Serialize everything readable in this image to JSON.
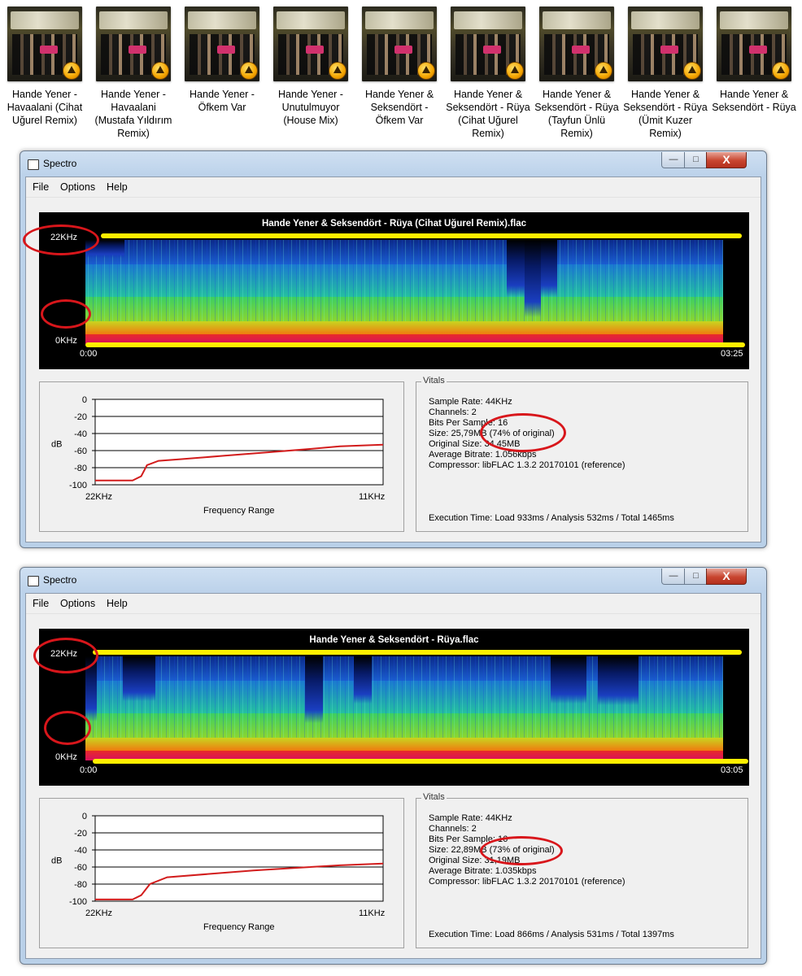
{
  "files": [
    {
      "name": "Hande Yener - Havaalani (Cihat Uğurel Remix)"
    },
    {
      "name": "Hande Yener - Havaalani (Mustafa Yıldırım Remix)"
    },
    {
      "name": "Hande Yener - Öfkem Var"
    },
    {
      "name": "Hande Yener - Unutulmuyor (House Mix)"
    },
    {
      "name": "Hande Yener & Seksendört - Öfkem Var"
    },
    {
      "name": "Hande Yener & Seksendört - Rüya (Cihat Uğurel Remix)"
    },
    {
      "name": "Hande Yener & Seksendört - Rüya (Tayfun Ünlü Remix)"
    },
    {
      "name": "Hande Yener & Seksendört - Rüya (Ümit Kuzer Remix)"
    },
    {
      "name": "Hande Yener & Seksendört - Rüya"
    }
  ],
  "windows": [
    {
      "title": "Spectro",
      "controls": {
        "minimize": "—",
        "maximize": "□",
        "close": "X"
      },
      "menu": [
        "File",
        "Options",
        "Help"
      ],
      "spectrogram": {
        "title": "Hande Yener & Seksendört - Rüya (Cihat Uğurel Remix).flac",
        "y_top": "22KHz",
        "y_bottom": "0KHz",
        "x_start": "0:00",
        "x_end": "03:25"
      },
      "graph": {
        "yticks": [
          "0",
          "-20",
          "-40",
          "-60",
          "-80",
          "-100"
        ],
        "ylabel": "dB",
        "x_left": "22KHz",
        "x_right": "11KHz",
        "xlabel": "Frequency Range",
        "chart_data": {
          "type": "line",
          "ylim": [
            -100,
            0
          ],
          "points": [
            [
              0,
              -95
            ],
            [
              0.13,
              -95
            ],
            [
              0.16,
              -90
            ],
            [
              0.18,
              -77
            ],
            [
              0.22,
              -72
            ],
            [
              0.3,
              -70
            ],
            [
              0.45,
              -66
            ],
            [
              0.6,
              -62
            ],
            [
              0.75,
              -58
            ],
            [
              0.85,
              -55
            ],
            [
              1,
              -53
            ]
          ]
        }
      },
      "vitals": {
        "legend": "Vitals",
        "sample_rate": "Sample Rate: 44KHz",
        "channels": "Channels: 2",
        "bits": "Bits Per Sample: 16",
        "size": "Size: 25,79MB (74% of original)",
        "original": "Original Size: 34,45MB",
        "bitrate": "Average Bitrate: 1.056kbps",
        "compressor": "Compressor: libFLAC 1.3.2 20170101 (reference)",
        "execution": "Execution Time: Load 933ms / Analysis 532ms / Total 1465ms"
      }
    },
    {
      "title": "Spectro",
      "controls": {
        "minimize": "—",
        "maximize": "□",
        "close": "X"
      },
      "menu": [
        "File",
        "Options",
        "Help"
      ],
      "spectrogram": {
        "title": "Hande Yener & Seksendört - Rüya.flac",
        "y_top": "22KHz",
        "y_bottom": "0KHz",
        "x_start": "0:00",
        "x_end": "03:05"
      },
      "graph": {
        "yticks": [
          "0",
          "-20",
          "-40",
          "-60",
          "-80",
          "-100"
        ],
        "ylabel": "dB",
        "x_left": "22KHz",
        "x_right": "11KHz",
        "xlabel": "Frequency Range",
        "chart_data": {
          "type": "line",
          "ylim": [
            -100,
            0
          ],
          "points": [
            [
              0,
              -98
            ],
            [
              0.13,
              -98
            ],
            [
              0.16,
              -93
            ],
            [
              0.19,
              -80
            ],
            [
              0.25,
              -72
            ],
            [
              0.4,
              -68
            ],
            [
              0.55,
              -64
            ],
            [
              0.7,
              -61
            ],
            [
              0.85,
              -58
            ],
            [
              1,
              -56
            ]
          ]
        }
      },
      "vitals": {
        "legend": "Vitals",
        "sample_rate": "Sample Rate: 44KHz",
        "channels": "Channels: 2",
        "bits": "Bits Per Sample: 16",
        "size": "Size: 22,89MB (73% of original)",
        "original": "Original Size: 31,19MB",
        "bitrate": "Average Bitrate: 1.035kbps",
        "compressor": "Compressor: libFLAC 1.3.2 20170101 (reference)",
        "execution": "Execution Time: Load 866ms / Analysis 531ms / Total 1397ms"
      }
    }
  ],
  "colors": {
    "annotation": "#d8161b",
    "yellow": "#ffef00",
    "graph_line": "#d21c1c"
  }
}
